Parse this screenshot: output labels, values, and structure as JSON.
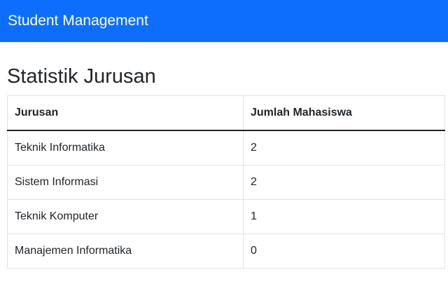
{
  "navbar": {
    "brand": "Student Management",
    "background_color": "#0d6efd"
  },
  "page": {
    "title": "Statistik Jurusan"
  },
  "table": {
    "headers": [
      "Jurusan",
      "Jumlah Mahasiswa"
    ],
    "rows": [
      [
        "Teknik Informatika",
        "2"
      ],
      [
        "Sistem Informasi",
        "2"
      ],
      [
        "Teknik Komputer",
        "1"
      ],
      [
        "Manajemen Informatika",
        "0"
      ]
    ]
  }
}
